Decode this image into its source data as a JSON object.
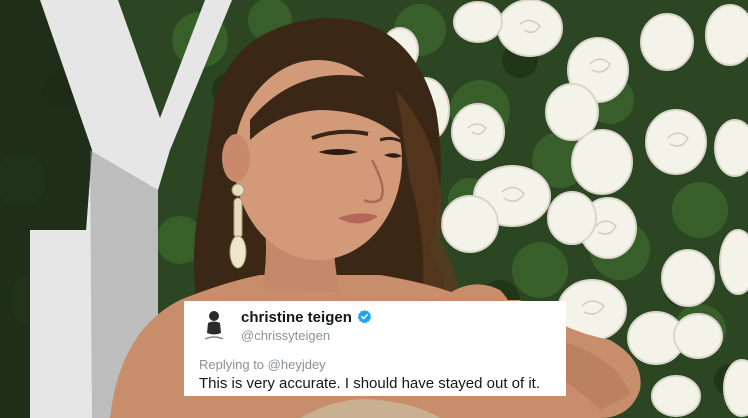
{
  "backdrop": {
    "letter": "Y"
  },
  "tweet": {
    "display_name": "christine teigen",
    "handle": "@chrissyteigen",
    "verified": true,
    "reply_prefix": "Replying to",
    "reply_to": "@heyjdey",
    "text": "This is very accurate. I should have stayed out of it.",
    "colors": {
      "verified_badge": "#1da1f2",
      "secondary_text": "#8a9299",
      "primary_text": "#14171a",
      "card_background": "#ffffff"
    },
    "icons": {
      "verified": "verified-badge-icon",
      "avatar": "profile-avatar"
    }
  }
}
